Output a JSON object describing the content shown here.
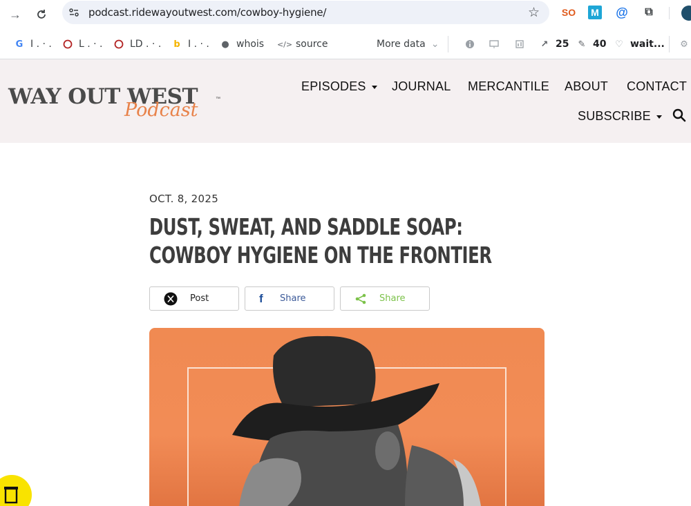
{
  "browser": {
    "url": "podcast.ridewayoutwest.com/cowboy-hygiene/",
    "bookmarks": [
      {
        "label": "I . · .",
        "icon": "google-icon"
      },
      {
        "label": "L . · .",
        "icon": "circle-icon"
      },
      {
        "label": "LD . · .",
        "icon": "circle-icon"
      },
      {
        "label": "I . · .",
        "icon": "bing-icon"
      },
      {
        "label": "whois",
        "icon": "person-icon"
      },
      {
        "label": "source",
        "icon": "code-icon"
      }
    ],
    "more_data": "More data",
    "stat_1": "25",
    "stat_2": "40",
    "wait": "wait..."
  },
  "site": {
    "logo_main": "WAY OUT WEST",
    "logo_sub": "Podcast",
    "logo_tm": "™",
    "nav": {
      "episodes": "EPISODES",
      "journal": "JOURNAL",
      "mercantile": "MERCANTILE",
      "about": "ABOUT",
      "contact": "CONTACT",
      "subscribe": "SUBSCRIBE"
    }
  },
  "article": {
    "date": "OCT. 8, 2025",
    "title_line1": "DUST, SWEAT, AND SADDLE SOAP:",
    "title_line2": "COWBOY HYGIENE ON THE FRONTIER",
    "share": {
      "x_label": "Post",
      "facebook_label": "Share",
      "generic_label": "Share"
    }
  },
  "colors": {
    "header_bg": "#f5f0f1",
    "accent_orange": "#f08a52",
    "facebook_blue": "#1877f2",
    "share_green": "#7cc24a"
  }
}
